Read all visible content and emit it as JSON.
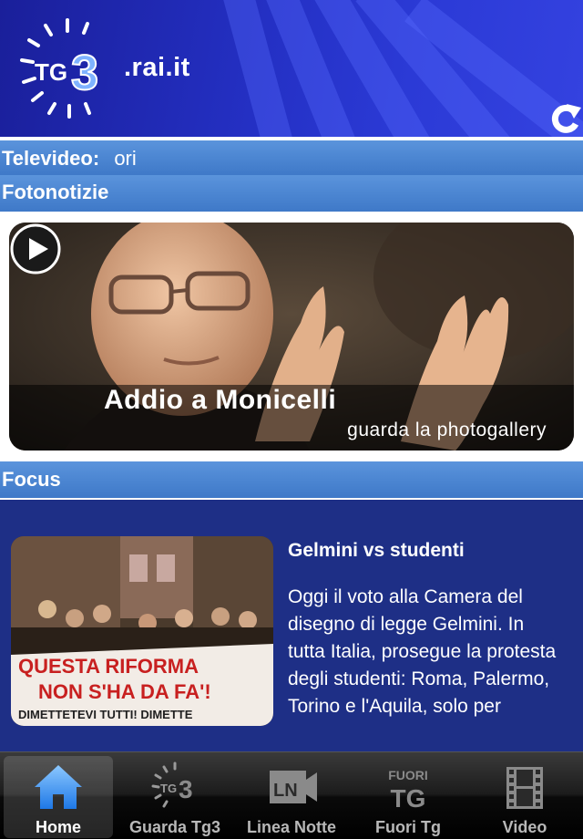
{
  "header": {
    "logo_text": "TG3",
    "domain": ".rai.it"
  },
  "televideo": {
    "label": "Televideo:",
    "ticker": "ori"
  },
  "fotonotizie": {
    "label": "Fotonotizie",
    "title": "Addio a Monicelli",
    "subtitle": "guarda la photogallery"
  },
  "focus": {
    "label": "Focus",
    "article_title": "Gelmini vs studenti",
    "article_text": "Oggi il voto alla Camera del disegno di legge Gelmini. In tutta Italia, prosegue la protesta degli studenti: Roma, Palermo, Torino e l'Aquila, solo per",
    "banner_text_1": "QUESTA RIFORMA",
    "banner_text_2": "NON S'HA DA FA'!",
    "banner_text_3": "DIMETTETEVI TUTTI! DIMETTE"
  },
  "tabs": [
    {
      "label": "Home",
      "icon": "home-icon",
      "active": true
    },
    {
      "label": "Guarda Tg3",
      "icon": "tg3-icon",
      "active": false
    },
    {
      "label": "Linea Notte",
      "icon": "linea-notte-icon",
      "active": false
    },
    {
      "label": "Fuori Tg",
      "icon": "fuori-tg-icon",
      "active": false,
      "icon_text_1": "FUORI",
      "icon_text_2": "TG"
    },
    {
      "label": "Video",
      "icon": "film-icon",
      "active": false
    }
  ]
}
